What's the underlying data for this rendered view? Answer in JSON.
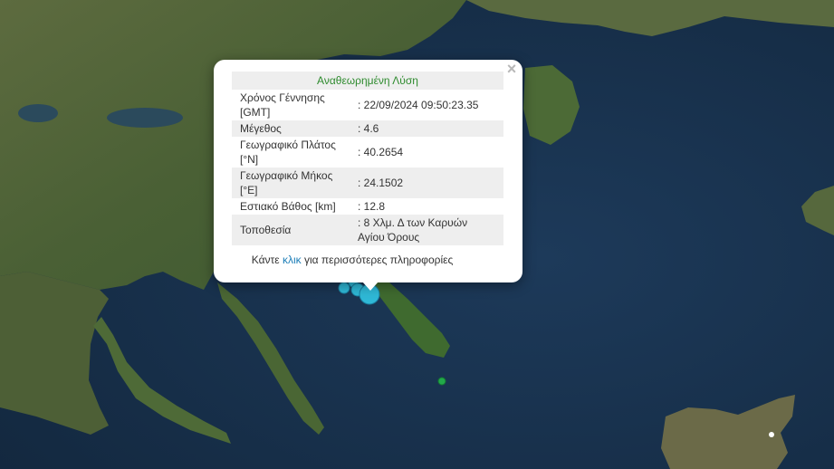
{
  "popup": {
    "title": "Αναθεωρημένη Λύση",
    "close_icon": "close-icon",
    "rows": [
      {
        "label": "Χρόνος Γέννησης [GMT]",
        "value": ": 22/09/2024 09:50:23.35"
      },
      {
        "label": "Μέγεθος",
        "value": ": 4.6"
      },
      {
        "label": "Γεωγραφικό Πλάτος [°N]",
        "value": ": 40.2654"
      },
      {
        "label": "Γεωγραφικό Μήκος [°E]",
        "value": ": 24.1502"
      },
      {
        "label": "Εστιακό Βάθος [km]",
        "value": ": 12.8"
      },
      {
        "label": "Τοποθεσία",
        "value": ": 8 Χλμ. Δ των Καρυών Αγίου Όρους"
      }
    ],
    "more_prefix": "Κάντε ",
    "more_link": "κλικ",
    "more_suffix": " για περισσότερες πληροφορίες"
  },
  "map": {
    "base_layer": "satellite",
    "marker_colors": {
      "recent": "#2fb8d6",
      "older": "#22a84a"
    }
  }
}
